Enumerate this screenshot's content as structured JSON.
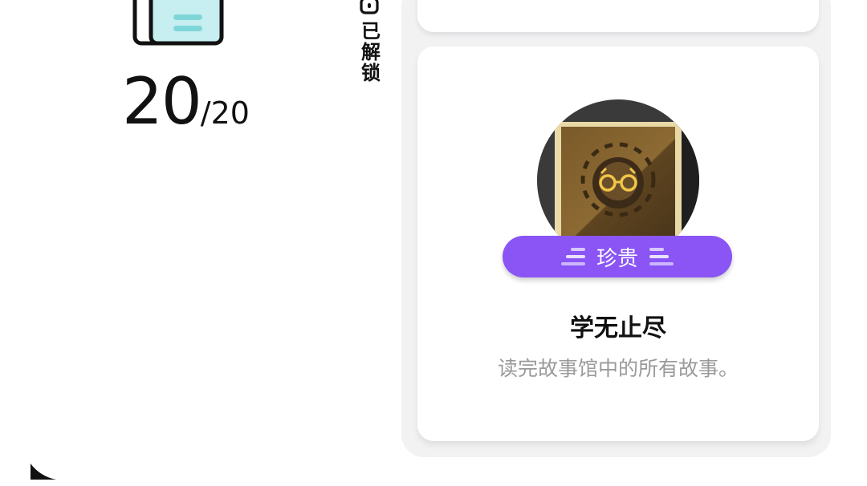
{
  "collection": {
    "unlocked_count": "20",
    "total": "/20",
    "status_label": "已解锁"
  },
  "achievement": {
    "rarity": "珍贵",
    "title": "学无止尽",
    "description": "读完故事馆中的所有故事。"
  },
  "colors": {
    "rarity_purple": "#8a55f4",
    "book_teal": "#c7eef0",
    "panel_bg": "#f2f2f3"
  }
}
